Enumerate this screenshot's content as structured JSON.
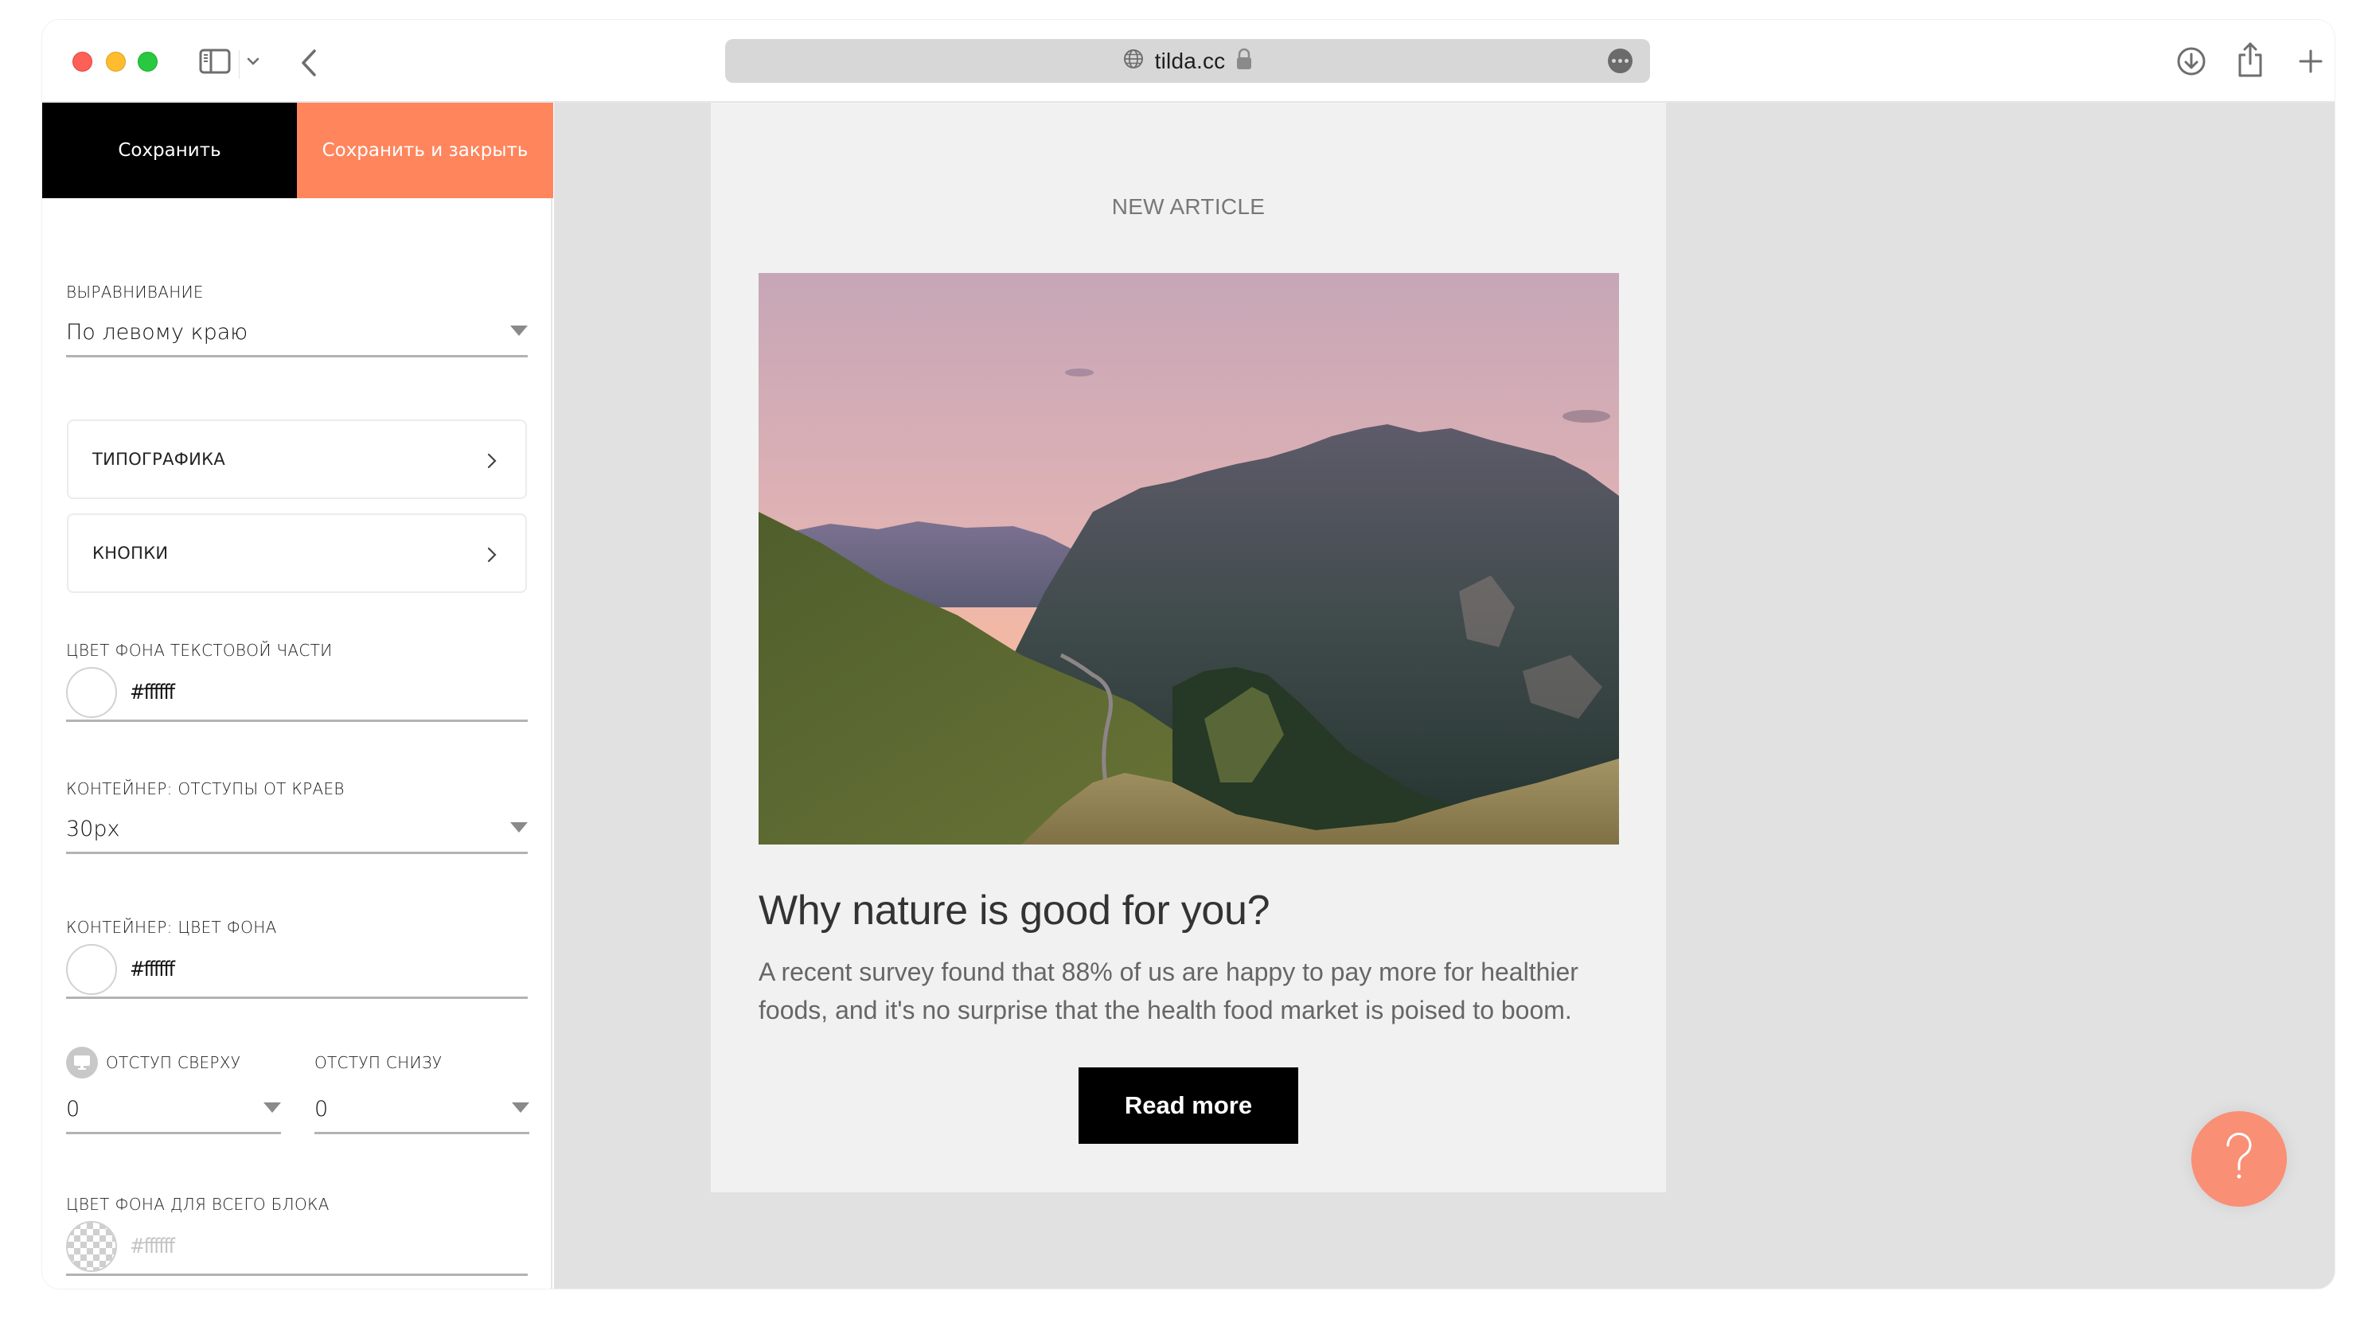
{
  "browser": {
    "url": "tilda.cc",
    "toolbar_icons": [
      "sidebar-icon",
      "chevron-down-icon",
      "back-icon",
      "globe-icon",
      "lock-icon",
      "more-icon",
      "download-icon",
      "share-icon",
      "plus-icon"
    ]
  },
  "panel": {
    "save_label": "Сохранить",
    "save_close_label": "Сохранить и закрыть",
    "alignment": {
      "label": "ВЫРАВНИВАНИЕ",
      "value": "По левому краю"
    },
    "typography": {
      "label": "ТИПОГРАФИКА"
    },
    "buttons": {
      "label": "КНОПКИ"
    },
    "text_bg_color": {
      "label": "ЦВЕТ ФОНА ТЕКСТОВОЙ ЧАСТИ",
      "value": "#ffffff"
    },
    "container_padding": {
      "label": "КОНТЕЙНЕР: ОТСТУПЫ ОТ КРАЕВ",
      "value": "30px"
    },
    "container_bg": {
      "label": "КОНТЕЙНЕР: ЦВЕТ ФОНА",
      "value": "#ffffff"
    },
    "padding_top": {
      "label": "ОТСТУП СВЕРХУ",
      "value": "0"
    },
    "padding_bottom": {
      "label": "ОТСТУП СНИЗУ",
      "value": "0"
    },
    "block_bg": {
      "label": "ЦВЕТ ФОНА ДЛЯ ВСЕГО БЛОКА",
      "placeholder": "#ffffff"
    }
  },
  "article": {
    "kicker": "NEW ARTICLE",
    "image_alt": "Mountain landscape at sunset with a winding road through green valley",
    "title": "Why nature is good for you?",
    "description": "A recent survey found that 88% of us are happy to pay more for healthier foods, and it's no surprise that the health food market is poised to boom.",
    "button_label": "Read more"
  },
  "help": {
    "label": "?"
  },
  "colors": {
    "accent": "#ff855d",
    "help_button": "#f98f75",
    "canvas_bg": "#e1e1e1",
    "card_bg": "#f1f1f1",
    "save_bg": "#000000"
  }
}
